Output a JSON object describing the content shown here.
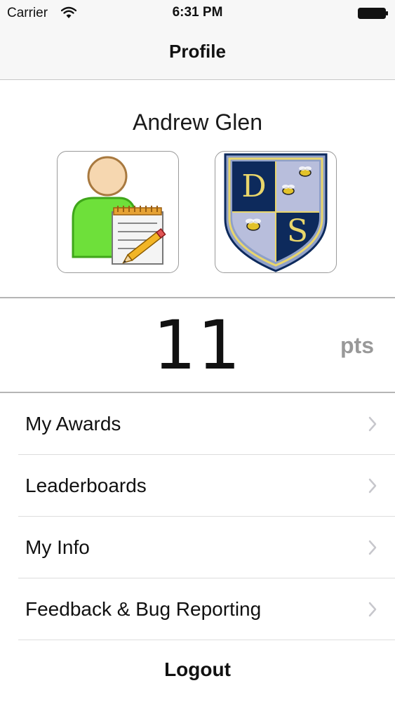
{
  "status_bar": {
    "carrier": "Carrier",
    "time": "6:31 PM",
    "icons": [
      "wifi-icon",
      "battery-icon"
    ]
  },
  "nav": {
    "title": "Profile"
  },
  "profile": {
    "name": "Andrew Glen",
    "images": [
      "avatar-with-notepad",
      "school-crest"
    ],
    "crest_letters": [
      "D",
      "S"
    ]
  },
  "points": {
    "value": "11",
    "unit": "pts"
  },
  "menu": {
    "items": [
      {
        "label": "My Awards"
      },
      {
        "label": "Leaderboards"
      },
      {
        "label": "My Info"
      },
      {
        "label": "Feedback & Bug Reporting"
      }
    ]
  },
  "logout_label": "Logout",
  "colors": {
    "nav_background": "#f7f7f7",
    "crest_navy": "#0d2a5c",
    "crest_light": "#b8bedc",
    "crest_gold": "#e9d66b",
    "avatar_green": "#6ee03a"
  }
}
